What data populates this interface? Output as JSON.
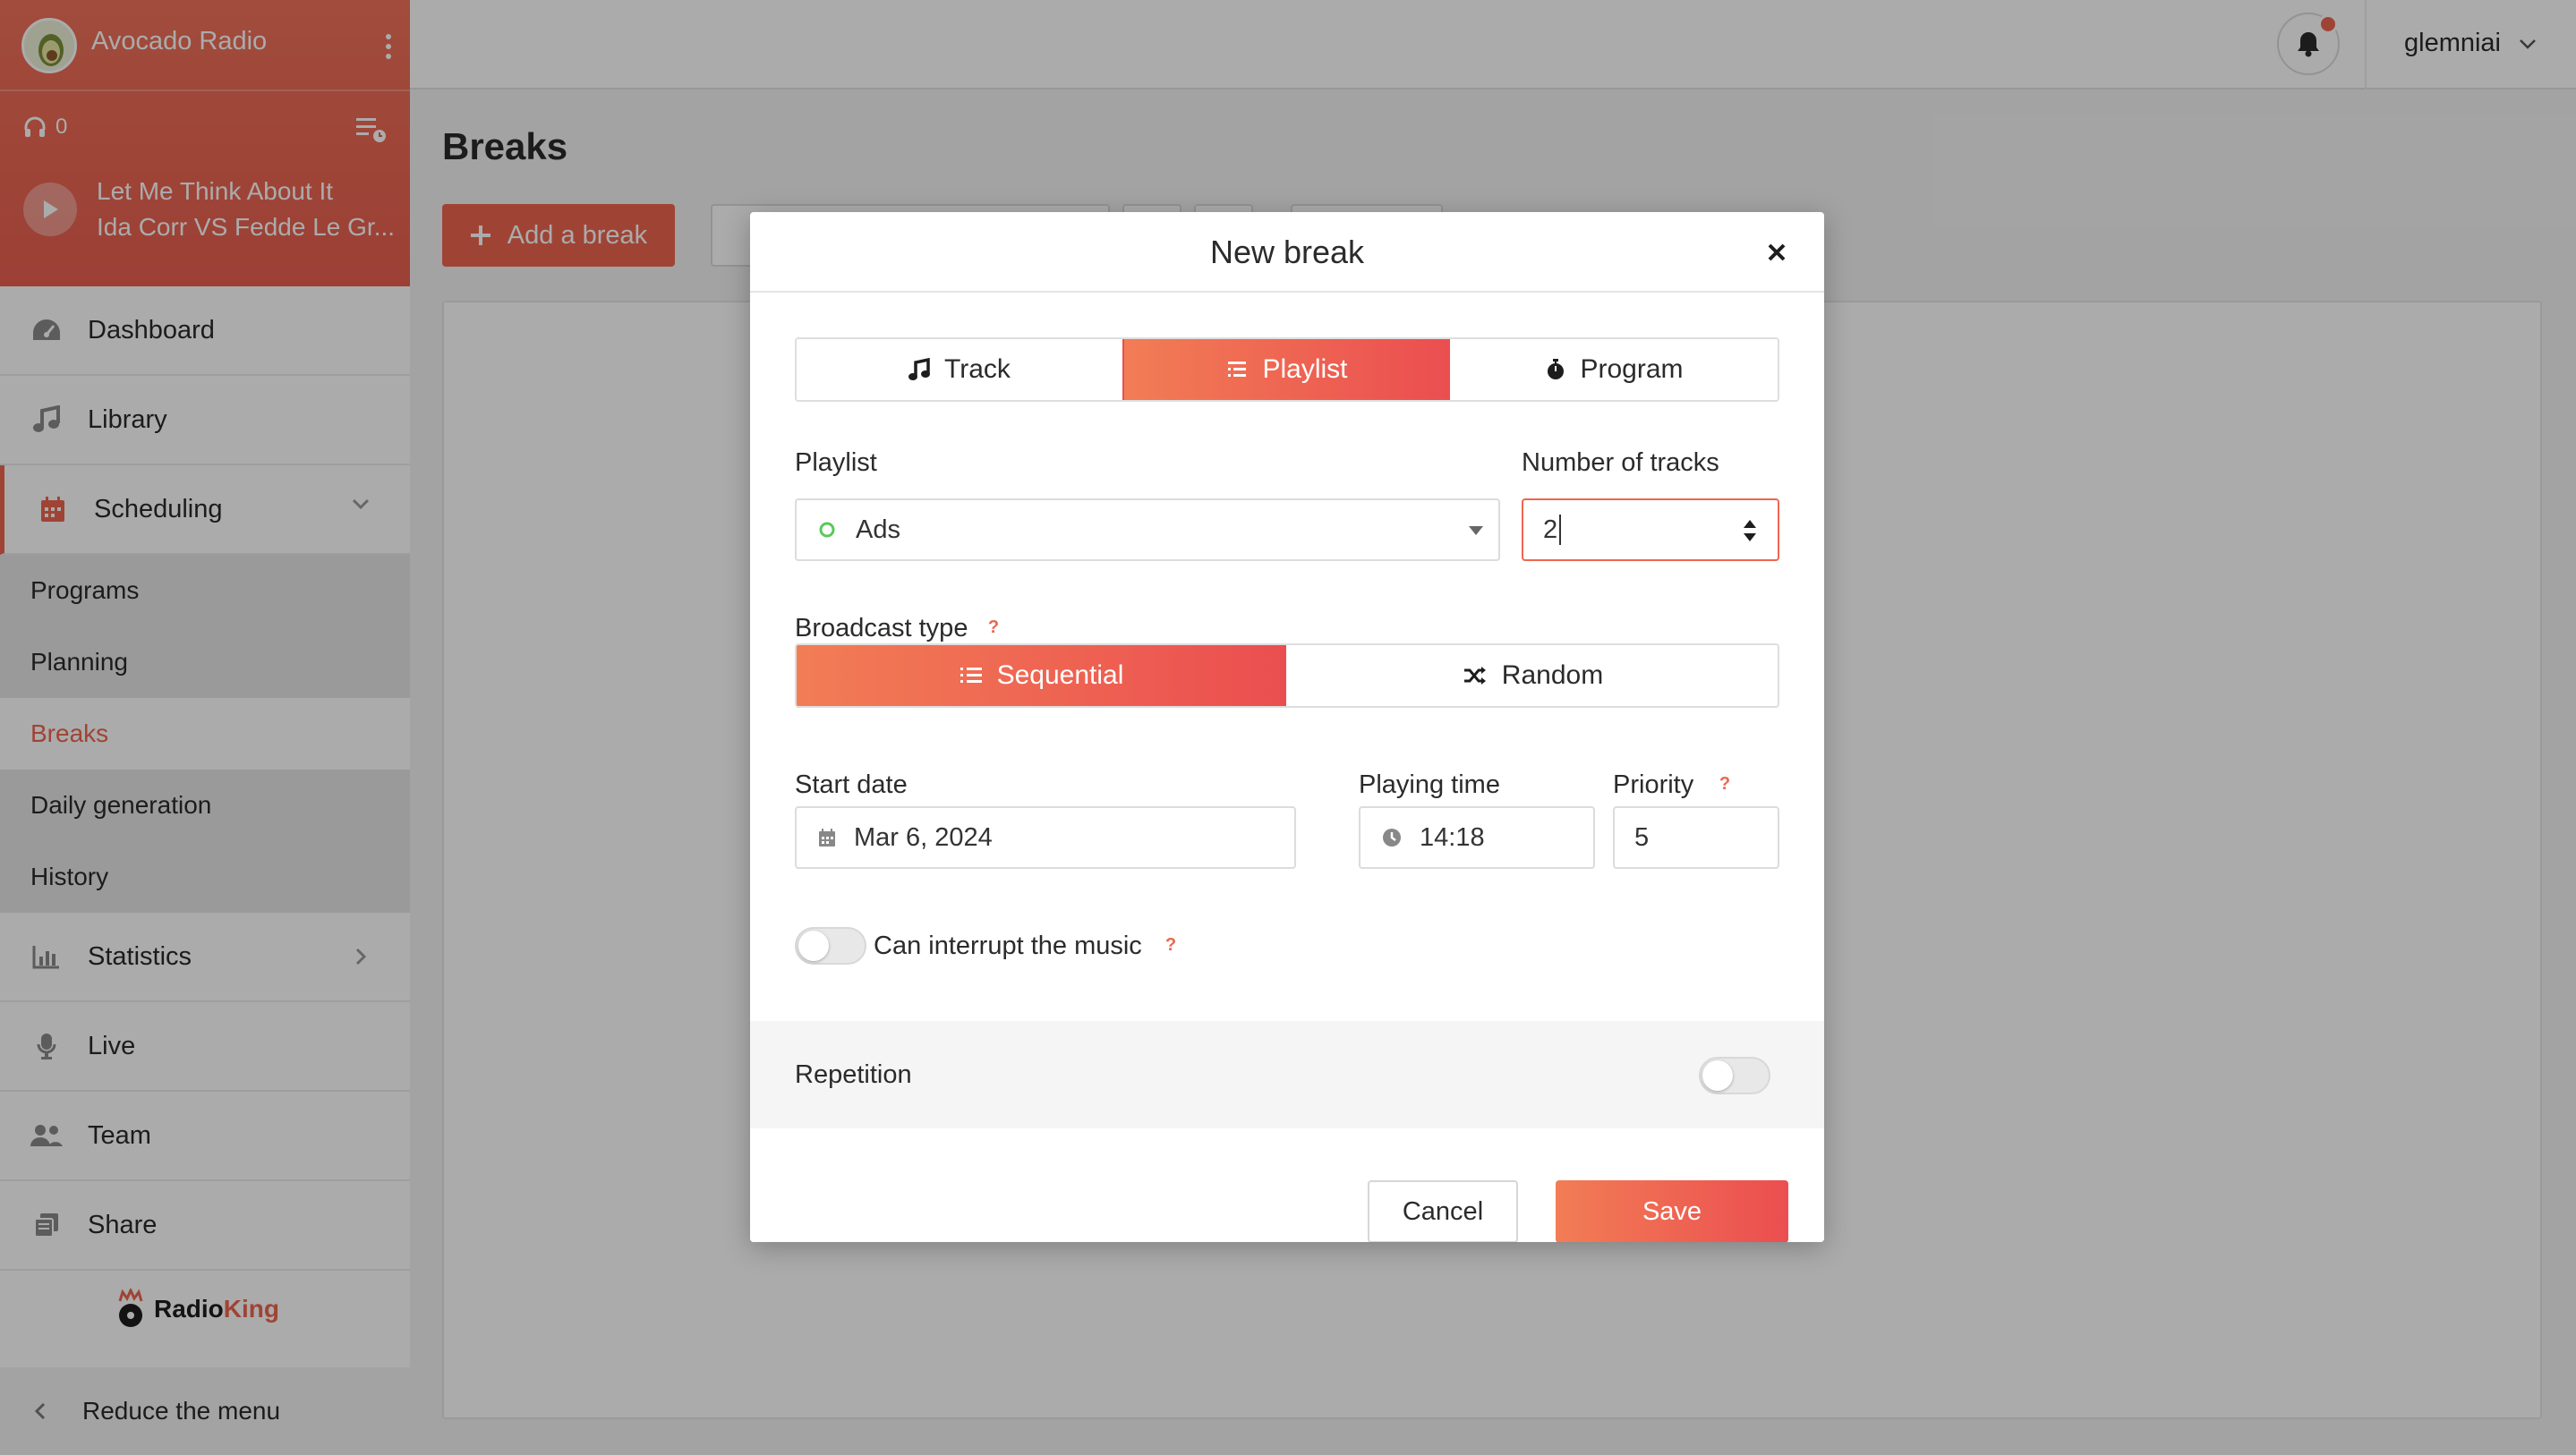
{
  "sidebar": {
    "radio_name": "Avocado Radio",
    "listeners": "0",
    "now_playing": {
      "title": "Let Me Think About It",
      "artist": "Ida Corr VS Fedde Le Gr..."
    },
    "nav": {
      "dashboard": "Dashboard",
      "library": "Library",
      "scheduling": "Scheduling",
      "statistics": "Statistics",
      "live": "Live",
      "team": "Team",
      "share": "Share"
    },
    "scheduling_sub": {
      "programs": "Programs",
      "planning": "Planning",
      "breaks": "Breaks",
      "daily_generation": "Daily generation",
      "history": "History"
    },
    "brand": {
      "part1": "Radio",
      "part2": "King"
    },
    "reduce_menu": "Reduce the menu"
  },
  "topbar": {
    "username": "glemniai"
  },
  "main": {
    "title": "Breaks",
    "add_button": "Add a break"
  },
  "modal": {
    "title": "New break",
    "type_tabs": {
      "track": "Track",
      "playlist": "Playlist",
      "program": "Program",
      "selected": "Playlist"
    },
    "playlist_label": "Playlist",
    "playlist_value": "Ads",
    "tracks_label": "Number of tracks",
    "tracks_value": "2",
    "broadcast_label": "Broadcast type",
    "broadcast": {
      "sequential": "Sequential",
      "random": "Random",
      "selected": "Sequential"
    },
    "start_date_label": "Start date",
    "start_date_value": "Mar 6, 2024",
    "playing_time_label": "Playing time",
    "playing_time_value": "14:18",
    "priority_label": "Priority",
    "priority_value": "5",
    "interrupt_label": "Can interrupt the music",
    "interrupt_on": false,
    "repetition_label": "Repetition",
    "repetition_on": false,
    "cancel": "Cancel",
    "save": "Save",
    "help_glyph": "?"
  },
  "colors": {
    "accent": "#ee6650",
    "gradient_start": "#f27d55",
    "gradient_end": "#eb4e50",
    "playlist_status": "#5bc85b"
  }
}
